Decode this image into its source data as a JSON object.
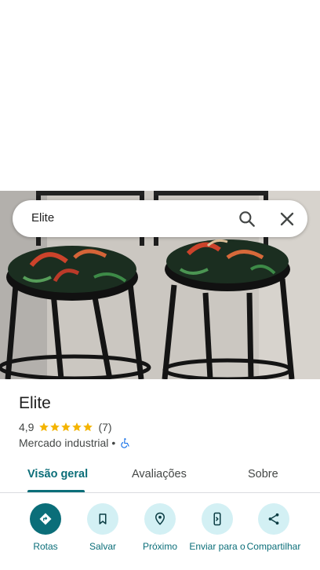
{
  "search": {
    "value": "Elite"
  },
  "place": {
    "title": "Elite",
    "rating": "4,9",
    "stars": 5,
    "review_count": "(7)",
    "category": "Mercado industrial",
    "separator": "•"
  },
  "tabs": [
    {
      "label": "Visão geral",
      "active": true
    },
    {
      "label": "Avaliações",
      "active": false
    },
    {
      "label": "Sobre",
      "active": false
    }
  ],
  "actions": [
    {
      "label": "Rotas",
      "icon": "directions-icon"
    },
    {
      "label": "Salvar",
      "icon": "bookmark-icon"
    },
    {
      "label": "Próximo",
      "icon": "nearby-icon"
    },
    {
      "label": "Enviar para o",
      "icon": "send-to-phone-icon"
    },
    {
      "label": "Compartilhar",
      "icon": "share-icon"
    }
  ],
  "colors": {
    "accent": "#0b6e79",
    "star": "#f4b400",
    "chip": "#d3f0f4"
  }
}
